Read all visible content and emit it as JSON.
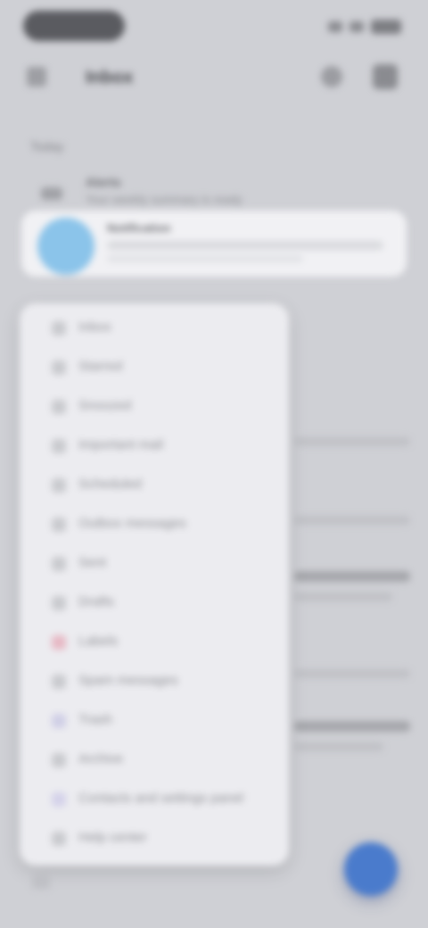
{
  "app_bar": {
    "title": "Inbox"
  },
  "section": {
    "label": "Today"
  },
  "message_preview": {
    "sender": "Alerts",
    "snippet": "Your weekly summary is ready"
  },
  "banner": {
    "sender": "Notification"
  },
  "menu": {
    "items": [
      {
        "label": "Inbox"
      },
      {
        "label": "Starred"
      },
      {
        "label": "Snoozed"
      },
      {
        "label": "Important mail"
      },
      {
        "label": "Scheduled"
      },
      {
        "label": "Outbox messages"
      },
      {
        "label": "Sent"
      },
      {
        "label": "Drafts"
      },
      {
        "label": "Labels"
      },
      {
        "label": "Spam messages"
      },
      {
        "label": "Trash"
      },
      {
        "label": "Archive"
      },
      {
        "label": "Contacts and settings panel"
      },
      {
        "label": "Help center"
      }
    ]
  },
  "colors": {
    "background": "#cfd0d5",
    "menu_background": "#ececf0",
    "accent": "#4a7bcc",
    "avatar": "#8bc4ea"
  }
}
